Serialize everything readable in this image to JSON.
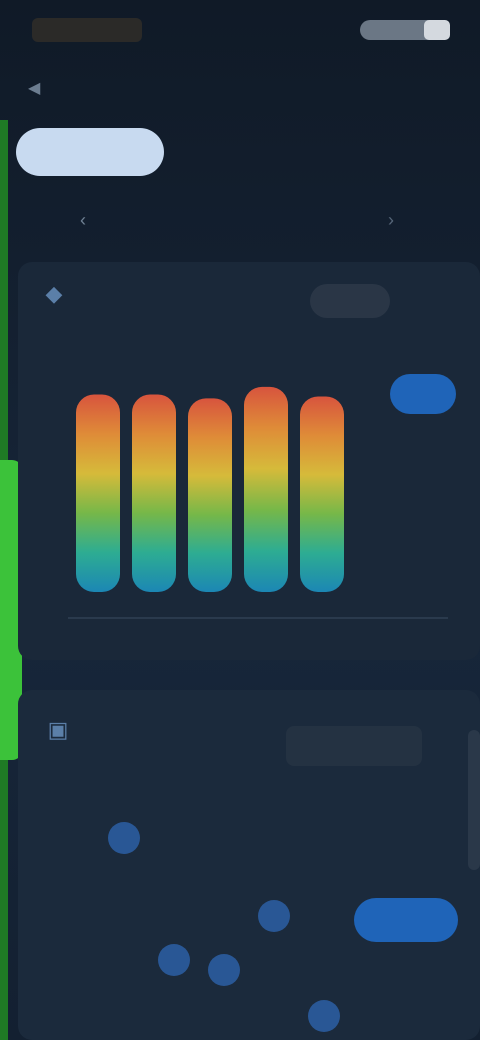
{
  "status": {
    "time": "",
    "icons": [
      "signal-icon",
      "wifi-icon",
      "battery-icon"
    ]
  },
  "header": {
    "title": "",
    "back_icon": "back-arrow-icon"
  },
  "tabs": [
    {
      "label": "",
      "active": true
    },
    {
      "label": "",
      "active": false
    },
    {
      "label": "",
      "active": false
    }
  ],
  "range": {
    "label": "",
    "prev_icon": "chevron-left-icon",
    "next_icon": "chevron-right-icon"
  },
  "card1": {
    "title": "",
    "subtitle": "",
    "value": "",
    "value_caption": "",
    "button_label": "",
    "chart_data": {
      "type": "bar",
      "categories": [
        "",
        "",
        "",
        "",
        ""
      ],
      "values": [
        82,
        82,
        80,
        86,
        81
      ],
      "ylim": [
        0,
        100
      ],
      "grid": false,
      "colors": [
        "#e8583e",
        "#f09438",
        "#e6c73a",
        "#7ec44a",
        "#2fb89a",
        "#1c8fbf"
      ]
    }
  },
  "card2": {
    "title": "",
    "subtitle": "",
    "value": "",
    "value_caption": "",
    "button_label": "",
    "points_color": "#2f67b3"
  },
  "colors": {
    "accent": "#3cc23a",
    "active_tab": "#c8daf0",
    "button": "#1f64b8"
  }
}
